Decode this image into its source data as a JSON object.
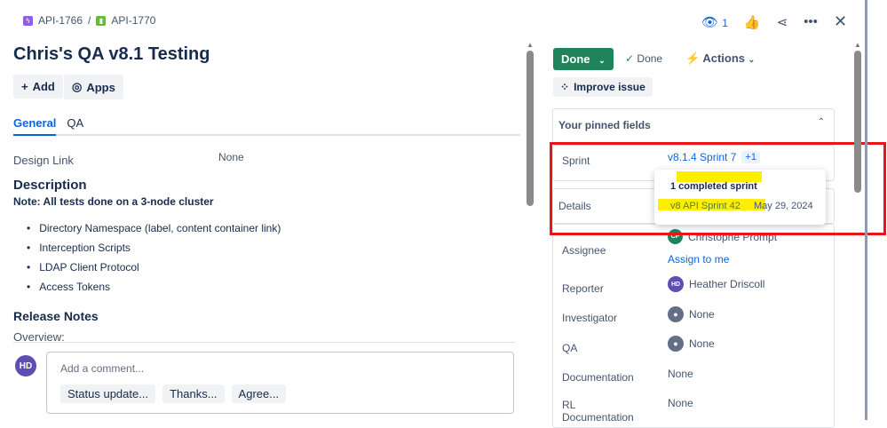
{
  "breadcrumb": {
    "parent": "API-1766",
    "separator": "/",
    "current": "API-1770"
  },
  "header": {
    "watch_count": "1"
  },
  "title": "Chris's QA v8.1 Testing",
  "toolbar": {
    "add": "Add",
    "apps": "Apps"
  },
  "tabs": [
    {
      "label": "General"
    },
    {
      "label": "QA"
    }
  ],
  "fields_left": {
    "design_link_label": "Design Link",
    "design_link_value": "None"
  },
  "description": {
    "heading": "Description",
    "note": "Note: All tests done on a 3-node cluster",
    "items": [
      "Directory Namespace (label, content container link)",
      "Interception Scripts",
      "LDAP Client Protocol",
      "Access Tokens"
    ]
  },
  "release_notes": {
    "heading": "Release Notes",
    "overview": "Overview:"
  },
  "comment": {
    "avatar": "HD",
    "placeholder": "Add a comment...",
    "quick": [
      "Status update...",
      "Thanks...",
      "Agree..."
    ]
  },
  "status": {
    "button": "Done",
    "resolution": "Done",
    "actions": "Actions",
    "improve": "Improve issue"
  },
  "pinned": {
    "heading": "Your pinned fields",
    "sprint_label": "Sprint",
    "sprint_value": "v8.1.4 Sprint 7",
    "sprint_more": "+1"
  },
  "popup": {
    "heading": "1 completed sprint",
    "sprint": "v8 API Sprint 42",
    "date": "May 29, 2024"
  },
  "details": {
    "heading": "Details",
    "fields": [
      {
        "label": "Assignee",
        "value": "Christophe Prompt",
        "avatar": "CP",
        "extra": "Assign to me"
      },
      {
        "label": "Reporter",
        "value": "Heather Driscoll",
        "avatar": "HD"
      },
      {
        "label": "Investigator",
        "value": "None"
      },
      {
        "label": "QA",
        "value": "None"
      },
      {
        "label": "Documentation",
        "value": "None"
      },
      {
        "label": "RL Documentation",
        "value": "None"
      }
    ]
  }
}
